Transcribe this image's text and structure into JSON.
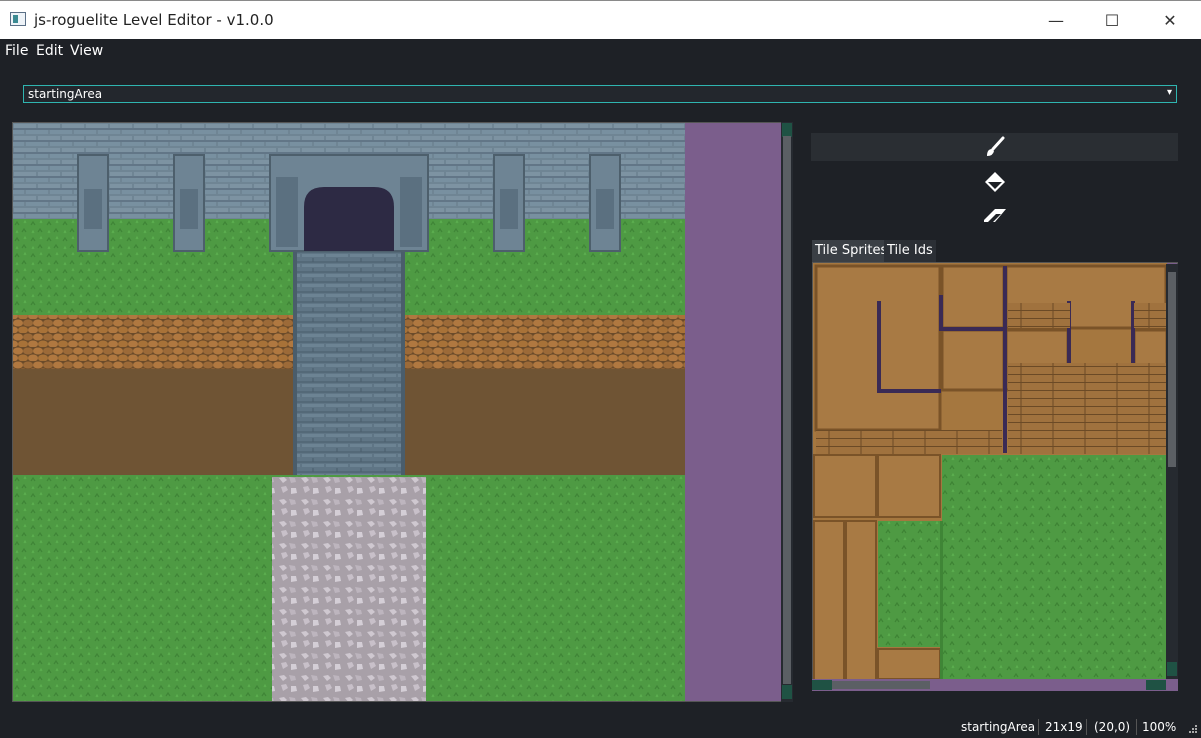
{
  "window": {
    "title": "js-roguelite Level Editor - v1.0.0"
  },
  "window_controls": {
    "minimize": "—",
    "maximize": "☐",
    "close": "✕"
  },
  "menu": {
    "file": "File",
    "edit": "Edit",
    "view": "View"
  },
  "level_select": {
    "value": "startingArea",
    "arrow": "▾"
  },
  "tabs": {
    "sprites": "Tile Sprites",
    "ids": "Tile Ids"
  },
  "status": {
    "level": "startingArea",
    "size": "21x19",
    "coords": "(20,0)",
    "zoom": "100%"
  },
  "colors": {
    "accent": "#2fb5b0",
    "background": "#1e2126",
    "void": "#7b5e8c"
  },
  "icons": [
    "paintbrush-icon",
    "fill-bucket-icon",
    "eraser-icon"
  ]
}
